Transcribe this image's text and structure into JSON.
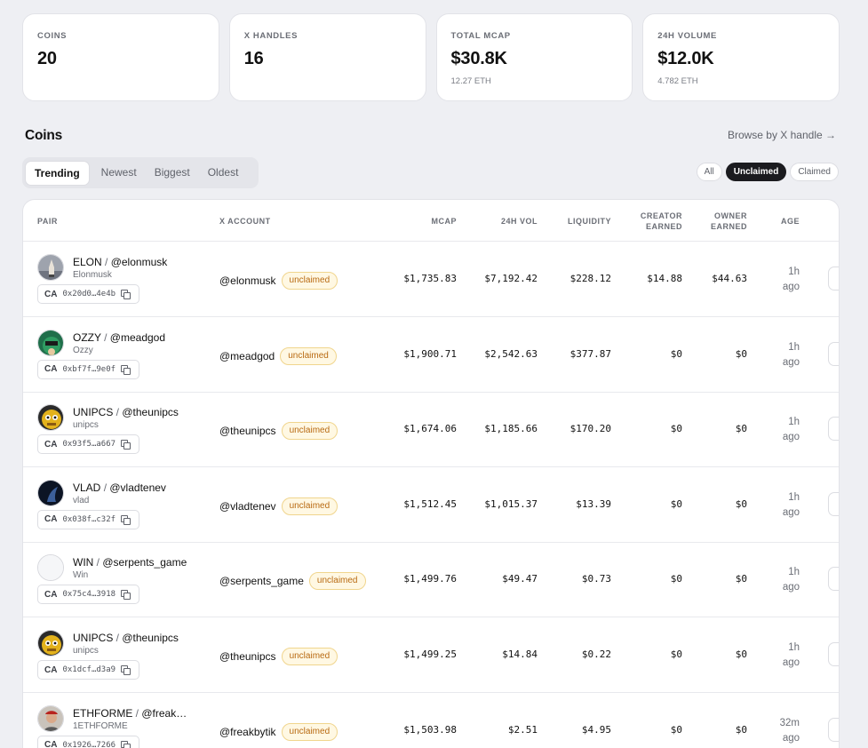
{
  "stats": [
    {
      "label": "COINS",
      "value": "20",
      "sub": ""
    },
    {
      "label": "X HANDLES",
      "value": "16",
      "sub": ""
    },
    {
      "label": "TOTAL MCAP",
      "value": "$30.8K",
      "sub": "12.27 ETH"
    },
    {
      "label": "24H VOLUME",
      "value": "$12.0K",
      "sub": "4.782 ETH"
    }
  ],
  "section": {
    "title": "Coins",
    "browse_link": "Browse by X handle →"
  },
  "sort_tabs": [
    "Trending",
    "Newest",
    "Biggest",
    "Oldest"
  ],
  "filters": [
    "All",
    "Unclaimed",
    "Claimed"
  ],
  "table": {
    "headers": {
      "pair": "PAIR",
      "x_account": "X ACCOUNT",
      "mcap": "MCAP",
      "vol": "24H VOL",
      "liquidity": "LIQUIDITY",
      "creator_1": "CREATOR",
      "creator_2": "EARNED",
      "owner_1": "OWNER",
      "owner_2": "EARNED",
      "age": "AGE"
    },
    "ca_label": "CA",
    "rows": [
      {
        "ticker": "ELON",
        "handle": "@elonmusk",
        "name": "Elonmusk",
        "ca": "0x20d0…4e4b",
        "x_account": "@elonmusk",
        "badge": "unclaimed",
        "mcap": "$1,735.83",
        "vol": "$7,192.42",
        "liquidity": "$228.12",
        "creator_earned": "$14.88",
        "owner_earned": "$44.63",
        "age_1": "1h",
        "age_2": "ago",
        "avatar": "rocket-avatar"
      },
      {
        "ticker": "OZZY",
        "handle": "@meadgod",
        "name": "Ozzy",
        "ca": "0xbf7f…9e0f",
        "x_account": "@meadgod",
        "badge": "unclaimed",
        "mcap": "$1,900.71",
        "vol": "$2,542.63",
        "liquidity": "$377.87",
        "creator_earned": "$0",
        "owner_earned": "$0",
        "age_1": "1h",
        "age_2": "ago",
        "avatar": "green-character-avatar"
      },
      {
        "ticker": "UNIPCS",
        "handle": "@theunipcs",
        "name": "unipcs",
        "ca": "0x93f5…a667",
        "x_account": "@theunipcs",
        "badge": "unclaimed",
        "mcap": "$1,674.06",
        "vol": "$1,185.66",
        "liquidity": "$170.20",
        "creator_earned": "$0",
        "owner_earned": "$0",
        "age_1": "1h",
        "age_2": "ago",
        "avatar": "yellow-character-avatar"
      },
      {
        "ticker": "VLAD",
        "handle": "@vladtenev",
        "name": "vlad",
        "ca": "0x038f…c32f",
        "x_account": "@vladtenev",
        "badge": "unclaimed",
        "mcap": "$1,512.45",
        "vol": "$1,015.37",
        "liquidity": "$13.39",
        "creator_earned": "$0",
        "owner_earned": "$0",
        "age_1": "1h",
        "age_2": "ago",
        "avatar": "dark-avatar"
      },
      {
        "ticker": "WIN",
        "handle": "@serpents_game",
        "name": "Win",
        "ca": "0x75c4…3918",
        "x_account": "@serpents_game",
        "badge": "unclaimed",
        "mcap": "$1,499.76",
        "vol": "$49.47",
        "liquidity": "$0.73",
        "creator_earned": "$0",
        "owner_earned": "$0",
        "age_1": "1h",
        "age_2": "ago",
        "avatar": "blank-avatar"
      },
      {
        "ticker": "UNIPCS",
        "handle": "@theunipcs",
        "name": "unipcs",
        "ca": "0x1dcf…d3a9",
        "x_account": "@theunipcs",
        "badge": "unclaimed",
        "mcap": "$1,499.25",
        "vol": "$14.84",
        "liquidity": "$0.22",
        "creator_earned": "$0",
        "owner_earned": "$0",
        "age_1": "1h",
        "age_2": "ago",
        "avatar": "yellow-character-avatar"
      },
      {
        "ticker": "ETHFORME",
        "handle": "@freak…",
        "name": "1ETHFORME",
        "ca": "0x1926…7266",
        "x_account": "@freakbytik",
        "badge": "unclaimed",
        "mcap": "$1,503.98",
        "vol": "$2.51",
        "liquidity": "$4.95",
        "creator_earned": "$0",
        "owner_earned": "$0",
        "age_1": "32m",
        "age_2": "ago",
        "avatar": "person-avatar"
      }
    ]
  },
  "colors": {
    "page_bg": "#eeeff3",
    "badge_text": "#b86a12",
    "badge_bg": "#fff8e3",
    "active_pill": "#1b1b1f"
  }
}
